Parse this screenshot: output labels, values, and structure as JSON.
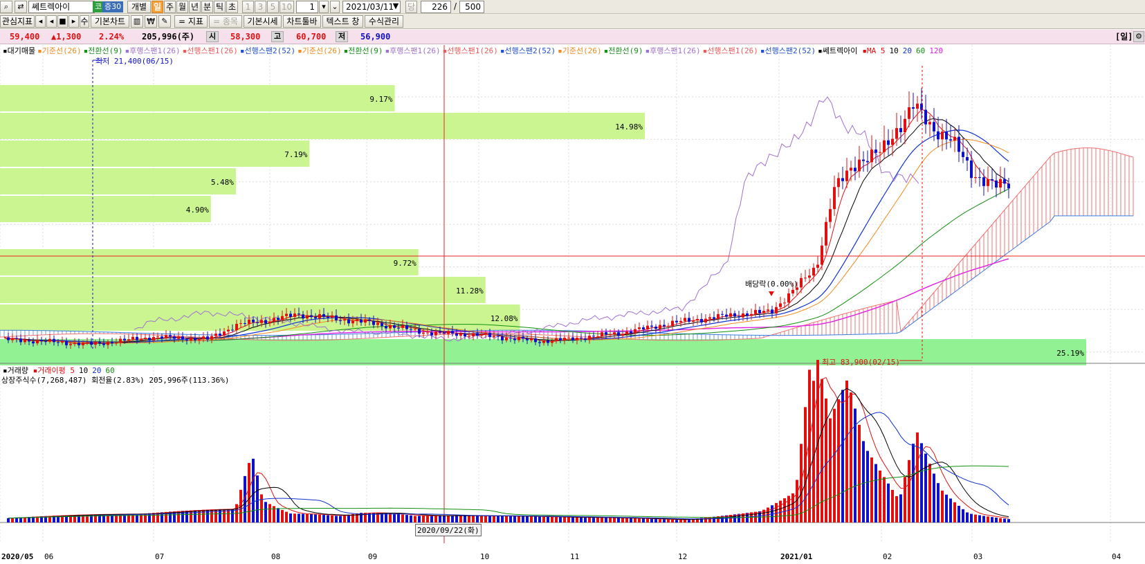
{
  "toolbar": {
    "stock_name": "쎄트렉아이",
    "market_badge": "코",
    "margin_badge": "증30",
    "individual_label": "개별",
    "periods": [
      "일",
      "주",
      "월",
      "년",
      "분",
      "틱",
      "초"
    ],
    "minute_steps": [
      "1",
      "3",
      "5",
      "10"
    ],
    "step_value": "1",
    "date_value": "2021/03/11",
    "when_label": "당",
    "count_value": "226",
    "slash": "/",
    "total_value": "500",
    "interest_indicator": "관심지표",
    "su_label": "수",
    "basic_chart": "기본차트",
    "won_label": "₩",
    "indicator_label": "= 지표",
    "item_label": "= 종목",
    "basic_quote": "기본시세",
    "chart_toolbar": "차트툴바",
    "text_label": "텍스트 창",
    "formula_label": "수식관리"
  },
  "price_bar": {
    "current_price": "59,400",
    "change": "▲1,300",
    "change_pct": "2.24%",
    "volume": "205,996(주)",
    "open_label": "시",
    "open_value": "58,300",
    "high_label": "고",
    "high_value": "60,700",
    "low_label": "저",
    "low_value": "56,900",
    "period_label": "[일]"
  },
  "legend": {
    "items": [
      {
        "text": "대기매물",
        "color": "#000000"
      },
      {
        "text": "기준선(26)",
        "color": "#f08a1c"
      },
      {
        "text": "전환선(9)",
        "color": "#1a8c1a"
      },
      {
        "text": "후행스팬1(26)",
        "color": "#a070d0"
      },
      {
        "text": "선행스팬1(26)",
        "color": "#ec5a5a"
      },
      {
        "text": "선행스팬2(52)",
        "color": "#2050d0"
      },
      {
        "text": "기준선(26)",
        "color": "#f08a1c"
      },
      {
        "text": "전환선(9)",
        "color": "#1a8c1a"
      },
      {
        "text": "후행스팬1(26)",
        "color": "#a070d0"
      },
      {
        "text": "선행스팬1(26)",
        "color": "#ec5a5a"
      },
      {
        "text": "선행스팬2(52)",
        "color": "#2050d0"
      },
      {
        "text": "기준선(26)",
        "color": "#f08a1c"
      },
      {
        "text": "전환선(9)",
        "color": "#1a8c1a"
      },
      {
        "text": "후행스팬1(26)",
        "color": "#a070d0"
      },
      {
        "text": "선행스팬1(26)",
        "color": "#ec5a5a"
      },
      {
        "text": "선행스팬2(52)",
        "color": "#2050d0"
      },
      {
        "text": "쎄트렉아이",
        "color": "#000000"
      }
    ],
    "ma_label": "MA",
    "ma_periods": [
      {
        "text": "5",
        "color": "#e01010"
      },
      {
        "text": "10",
        "color": "#000000"
      },
      {
        "text": "20",
        "color": "#1030d0"
      },
      {
        "text": "60",
        "color": "#109010"
      },
      {
        "text": "120",
        "color": "#e020e0"
      }
    ]
  },
  "annotations": {
    "low_note": "최저 21,400(06/15)",
    "high_note": "최고 83,900(02/15)",
    "dividend_note": "배당락(0.00%)"
  },
  "volume_panel": {
    "legend_volume": "거래량",
    "legend_avg": "거래이평",
    "avg_periods": [
      {
        "text": "5",
        "color": "#e01010"
      },
      {
        "text": "10",
        "color": "#000000"
      },
      {
        "text": "20",
        "color": "#1030d0"
      },
      {
        "text": "60",
        "color": "#109010"
      }
    ],
    "info": "상장주식수(7,268,487) 회전율(2.83%) 205,996주(113.36%)"
  },
  "cursor_date": "2020/09/22(화)",
  "x_axis_labels": [
    "2020/05",
    "06",
    "07",
    "08",
    "09",
    "10",
    "11",
    "12",
    "2021/01",
    "02",
    "03",
    "04"
  ],
  "colors": {
    "up": "#e01010",
    "down": "#1010c8",
    "profile": "#c8f48a",
    "profile_main": "#8cf08c",
    "crosshair": "#ee2020",
    "cloud_up": "#f07070",
    "cloud_down": "#6a9ae0"
  },
  "chart_data": [
    {
      "type": "bar",
      "title": "대기매물",
      "categories": [
        "band-1",
        "band-2",
        "band-3",
        "band-4",
        "band-5",
        "band-6",
        "band-7",
        "band-8",
        "band-9"
      ],
      "values": [
        9.17,
        14.98,
        7.19,
        5.48,
        4.9,
        9.72,
        11.28,
        12.08,
        25.19
      ],
      "labels": [
        "9.17%",
        "14.98%",
        "7.19%",
        "5.48%",
        "4.90%",
        "9.72%",
        "11.28%",
        "12.08%",
        "25.19%"
      ]
    },
    {
      "type": "line",
      "title": "쎄트렉아이",
      "x": [
        "2020/05",
        "2020/06",
        "2020/07",
        "2020/08",
        "2020/09",
        "2020/10",
        "2020/11",
        "2020/12",
        "2021/01",
        "2021/02",
        "2021/03"
      ],
      "series": [
        {
          "name": "쎄트렉아이",
          "values": [
            23000,
            22000,
            23500,
            27500,
            27000,
            24500,
            22500,
            27000,
            29000,
            60000,
            59400
          ]
        }
      ]
    },
    {
      "type": "bar",
      "title": "거래량",
      "x": [
        "2020/05",
        "2020/06",
        "2020/07",
        "2020/08",
        "2020/09",
        "2020/10",
        "2020/11",
        "2020/12",
        "2021/01",
        "2021/02",
        "2021/03"
      ],
      "series": [
        {
          "name": "거래량",
          "values": [
            15000,
            20000,
            18000,
            90000,
            20000,
            8000,
            6000,
            9000,
            200000,
            150000,
            20000
          ]
        }
      ]
    }
  ]
}
